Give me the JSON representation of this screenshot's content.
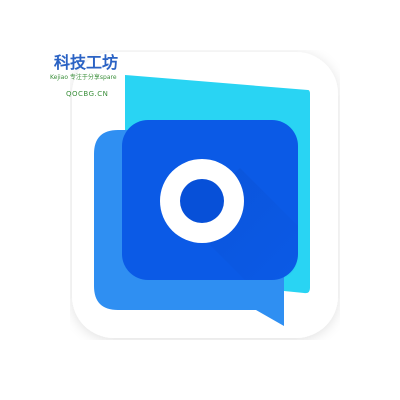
{
  "icon": {
    "name": "chat-bubble-app-icon",
    "colors": {
      "tile": "#ffffff",
      "back_bubble": "#29d4f3",
      "middle_bubble": "#2f8ff2",
      "front_bubble": "#0b5ae6",
      "shadow": "#0a4fd0",
      "ring": "#ffffff",
      "dot": "#0750d8"
    }
  },
  "watermark": {
    "title": "科技工坊",
    "subtitle": "Kejiao 专注于分享spare",
    "url": "QOCBG.CN",
    "colors": {
      "title": "#2a62c4",
      "accent": "#3b8f3b"
    }
  }
}
